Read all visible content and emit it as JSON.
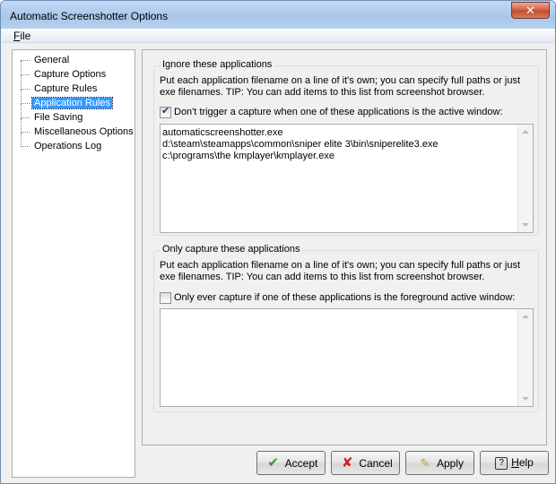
{
  "window": {
    "title": "Automatic Screenshotter Options",
    "close_glyph": "✕"
  },
  "menubar": {
    "file_accel": "F",
    "file_rest": "ile"
  },
  "tree": {
    "items": [
      {
        "label": "General",
        "selected": false
      },
      {
        "label": "Capture Options",
        "selected": false
      },
      {
        "label": "Capture Rules",
        "selected": false
      },
      {
        "label": "Application Rules",
        "selected": true
      },
      {
        "label": "File Saving",
        "selected": false
      },
      {
        "label": "Miscellaneous Options",
        "selected": false
      },
      {
        "label": "Operations Log",
        "selected": false
      }
    ]
  },
  "ignore": {
    "legend": "Ignore these applications",
    "description": "Put each application filename on a line of it's own; you can specify full paths or just exe filenames. TIP: You can add items to this list from screenshot browser.",
    "checkbox_label": "Don't trigger a capture when one of these applications is the active window:",
    "checked": true,
    "list_text": "automaticscreenshotter.exe\nd:\\steam\\steamapps\\common\\sniper elite 3\\bin\\sniperelite3.exe\nc:\\programs\\the kmplayer\\kmplayer.exe"
  },
  "only": {
    "legend": "Only capture these applications",
    "description": "Put each application filename on a line of it's own; you can specify full paths or just exe filenames. TIP: You can add items to this list from screenshot browser.",
    "checkbox_label": "Only ever capture if one of these applications is the foreground active window:",
    "checked": false,
    "list_text": ""
  },
  "buttons": {
    "accept": "Accept",
    "cancel": "Cancel",
    "apply": "Apply",
    "help_accel": "H",
    "help_rest": "elp"
  },
  "icons": {
    "accept": "check-icon",
    "cancel": "x-icon",
    "apply": "pencil-icon",
    "help": "help-icon"
  },
  "colors": {
    "selection": "#3399ff",
    "titlebar": "#a9c6ea"
  }
}
